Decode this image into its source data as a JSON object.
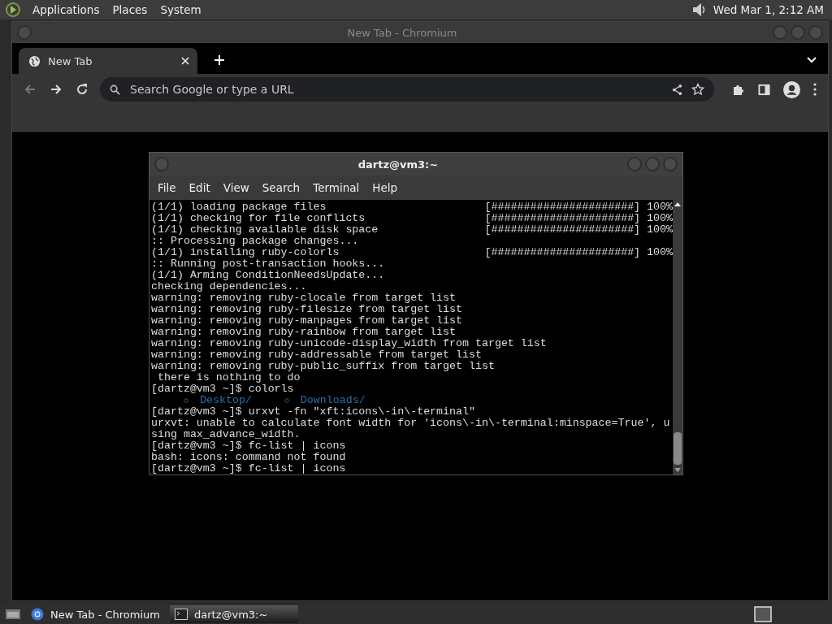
{
  "top_panel": {
    "menus": [
      "Applications",
      "Places",
      "System"
    ],
    "clock": "Wed Mar 1,  2:12 AM"
  },
  "browser": {
    "title": "New Tab - Chromium",
    "tabs": [
      {
        "label": "New Tab",
        "selected": true
      }
    ],
    "omnibox": {
      "placeholder": "Search Google or type a URL"
    }
  },
  "terminal": {
    "title": "dartz@vm3:~",
    "menus": [
      "File",
      "Edit",
      "View",
      "Search",
      "Terminal",
      "Help"
    ],
    "lines": [
      {
        "kind": "text",
        "text": "(1/1) loading package files",
        "progress": "[######################] 100%"
      },
      {
        "kind": "text",
        "text": "(1/1) checking for file conflicts",
        "progress": "[######################] 100%"
      },
      {
        "kind": "text",
        "text": "(1/1) checking available disk space",
        "progress": "[######################] 100%"
      },
      {
        "kind": "text",
        "text": ":: Processing package changes..."
      },
      {
        "kind": "text",
        "text": "(1/1) installing ruby-colorls",
        "progress": "[######################] 100%"
      },
      {
        "kind": "text",
        "text": ":: Running post-transaction hooks..."
      },
      {
        "kind": "text",
        "text": "(1/1) Arming ConditionNeedsUpdate..."
      },
      {
        "kind": "text",
        "text": "checking dependencies..."
      },
      {
        "kind": "text",
        "text": "warning: removing ruby-clocale from target list"
      },
      {
        "kind": "text",
        "text": "warning: removing ruby-filesize from target list"
      },
      {
        "kind": "text",
        "text": "warning: removing ruby-manpages from target list"
      },
      {
        "kind": "text",
        "text": "warning: removing ruby-rainbow from target list"
      },
      {
        "kind": "text",
        "text": "warning: removing ruby-unicode-display_width from target list"
      },
      {
        "kind": "text",
        "text": "warning: removing ruby-addressable from target list"
      },
      {
        "kind": "text",
        "text": "warning: removing ruby-public_suffix from target list"
      },
      {
        "kind": "text",
        "text": " there is nothing to do"
      },
      {
        "kind": "text",
        "text": "[dartz@vm3 ~]$ colorls"
      },
      {
        "kind": "listing",
        "entries": [
          "Desktop/",
          "Downloads/"
        ]
      },
      {
        "kind": "text",
        "text": "[dartz@vm3 ~]$ urxvt -fn \"xft:icons\\-in\\-terminal\""
      },
      {
        "kind": "text",
        "text": "urxvt: unable to calculate font width for 'icons\\-in\\-terminal:minspace=True', u"
      },
      {
        "kind": "text",
        "text": "sing max_advance_width."
      },
      {
        "kind": "text",
        "text": "[dartz@vm3 ~]$ fc-list | icons"
      },
      {
        "kind": "text",
        "text": "bash: icons: command not found"
      },
      {
        "kind": "text",
        "text": "[dartz@vm3 ~]$ fc-list | icons"
      }
    ]
  },
  "taskbar": {
    "tasks": [
      {
        "label": "New Tab - Chromium",
        "selected": false,
        "kind": "browser"
      },
      {
        "label": "dartz@vm3:~",
        "selected": true,
        "kind": "terminal"
      }
    ]
  }
}
